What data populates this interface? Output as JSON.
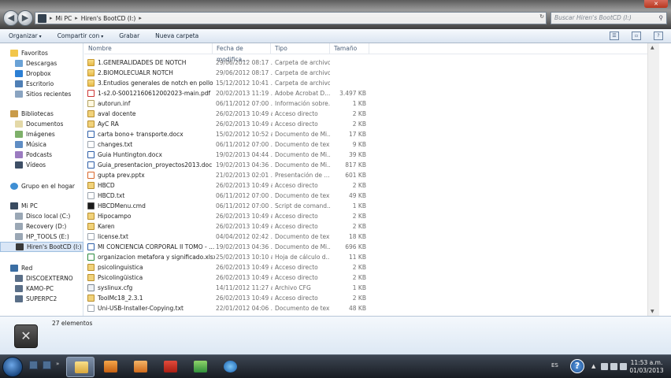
{
  "address_bar": {
    "crumbs": [
      "Mi PC",
      "Hiren's BootCD (I:)"
    ],
    "search_placeholder": "Buscar Hiren's BootCD (I:)"
  },
  "toolbar": {
    "organize_label": "Organizar",
    "share_label": "Compartir con",
    "burn_label": "Grabar",
    "new_folder_label": "Nueva carpeta"
  },
  "sidebar": {
    "favorites": {
      "header": "Favoritos",
      "items": [
        "Descargas",
        "Dropbox",
        "Escritorio",
        "Sitios recientes"
      ]
    },
    "libraries": {
      "header": "Bibliotecas",
      "items": [
        "Documentos",
        "Imágenes",
        "Música",
        "Podcasts",
        "Vídeos"
      ]
    },
    "homegroup": {
      "header": "Grupo en el hogar"
    },
    "computer": {
      "header": "Mi PC",
      "items": [
        "Disco local (C:)",
        "Recovery (D:)",
        "HP_TOOLS (E:)",
        "Hiren's BootCD (I:)"
      ],
      "selected": "Hiren's BootCD (I:)"
    },
    "network": {
      "header": "Red",
      "items": [
        "DISCOEXTERNO",
        "KAMO-PC",
        "SUPERPC2"
      ]
    }
  },
  "columns": {
    "name": "Nombre",
    "date": "Fecha de modifica...",
    "type": "Tipo",
    "size": "Tamaño"
  },
  "files": [
    {
      "name": "1.GENERALIDADES DE NOTCH",
      "date": "29/06/2012 08:17 ...",
      "type": "Carpeta de archivos",
      "size": "",
      "icon": "folder"
    },
    {
      "name": "2.BIOMOLECUALR NOTCH",
      "date": "29/06/2012 08:17 ...",
      "type": "Carpeta de archivos",
      "size": "",
      "icon": "folder"
    },
    {
      "name": "3.Entudios generales de notch en pollo",
      "date": "15/12/2012 10:41 ...",
      "type": "Carpeta de archivos",
      "size": "",
      "icon": "folder"
    },
    {
      "name": "1-s2.0-S0012160612002023-main.pdf",
      "date": "20/02/2013 11:19 ...",
      "type": "Adobe Acrobat D...",
      "size": "3.497 KB",
      "icon": "pdf"
    },
    {
      "name": "autorun.inf",
      "date": "06/11/2012 07:00 ...",
      "type": "Información sobre...",
      "size": "1 KB",
      "icon": "inf"
    },
    {
      "name": "aval docente",
      "date": "26/02/2013 10:49 a...",
      "type": "Acceso directo",
      "size": "2 KB",
      "icon": "lnk"
    },
    {
      "name": "AyC RA",
      "date": "26/02/2013 10:49 a...",
      "type": "Acceso directo",
      "size": "2 KB",
      "icon": "lnk"
    },
    {
      "name": "carta bono+ transporte.docx",
      "date": "15/02/2012 10:52 a...",
      "type": "Documento de Mi...",
      "size": "17 KB",
      "icon": "doc"
    },
    {
      "name": "changes.txt",
      "date": "06/11/2012 07:00 ...",
      "type": "Documento de tex...",
      "size": "9 KB",
      "icon": "txt"
    },
    {
      "name": "Guia Huntington.docx",
      "date": "19/02/2013 04:44 ...",
      "type": "Documento de Mi...",
      "size": "39 KB",
      "icon": "doc"
    },
    {
      "name": "Guia_presentacion_proyectos2013.doc",
      "date": "19/02/2013 04:36 ...",
      "type": "Documento de Mi...",
      "size": "817 KB",
      "icon": "doc"
    },
    {
      "name": "gupta prev.pptx",
      "date": "21/02/2013 02:01 ...",
      "type": "Presentación de ...",
      "size": "601 KB",
      "icon": "ppt"
    },
    {
      "name": "HBCD",
      "date": "26/02/2013 10:49 a...",
      "type": "Acceso directo",
      "size": "2 KB",
      "icon": "lnk"
    },
    {
      "name": "HBCD.txt",
      "date": "06/11/2012 07:00 ...",
      "type": "Documento de tex...",
      "size": "49 KB",
      "icon": "txt"
    },
    {
      "name": "HBCDMenu.cmd",
      "date": "06/11/2012 07:00 ...",
      "type": "Script de comand...",
      "size": "1 KB",
      "icon": "cmd"
    },
    {
      "name": "Hipocampo",
      "date": "26/02/2013 10:49 a...",
      "type": "Acceso directo",
      "size": "2 KB",
      "icon": "lnk"
    },
    {
      "name": "Karen",
      "date": "26/02/2013 10:49 a...",
      "type": "Acceso directo",
      "size": "2 KB",
      "icon": "lnk"
    },
    {
      "name": "license.txt",
      "date": "04/04/2012 02:42 ...",
      "type": "Documento de tex...",
      "size": "18 KB",
      "icon": "txt"
    },
    {
      "name": "MI CONCIENCIA CORPORAL  II TOMO - ...",
      "date": "19/02/2013 04:36 ...",
      "type": "Documento de Mi...",
      "size": "696 KB",
      "icon": "doc"
    },
    {
      "name": "organizacion metafora y significado.xlsx",
      "date": "25/02/2013 10:10 a...",
      "type": "Hoja de cálculo d...",
      "size": "11 KB",
      "icon": "xls"
    },
    {
      "name": "psicolinguistica",
      "date": "26/02/2013 10:49 a...",
      "type": "Acceso directo",
      "size": "2 KB",
      "icon": "lnk"
    },
    {
      "name": "Psicolingüistica",
      "date": "26/02/2013 10:49 a...",
      "type": "Acceso directo",
      "size": "2 KB",
      "icon": "lnk"
    },
    {
      "name": "syslinux.cfg",
      "date": "14/11/2012 11:27 a...",
      "type": "Archivo CFG",
      "size": "1 KB",
      "icon": "cfg"
    },
    {
      "name": "ToolMc18_2.3.1",
      "date": "26/02/2013 10:49 a...",
      "type": "Acceso directo",
      "size": "2 KB",
      "icon": "lnk"
    },
    {
      "name": "Uni-USB-Installer-Copying.txt",
      "date": "22/01/2012 04:06 ...",
      "type": "Documento de tex...",
      "size": "48 KB",
      "icon": "txt"
    }
  ],
  "details": {
    "count": "27 elementos"
  },
  "taskbar": {
    "language": "ES",
    "time": "11:53 a.m.",
    "date": "01/03/2013"
  }
}
